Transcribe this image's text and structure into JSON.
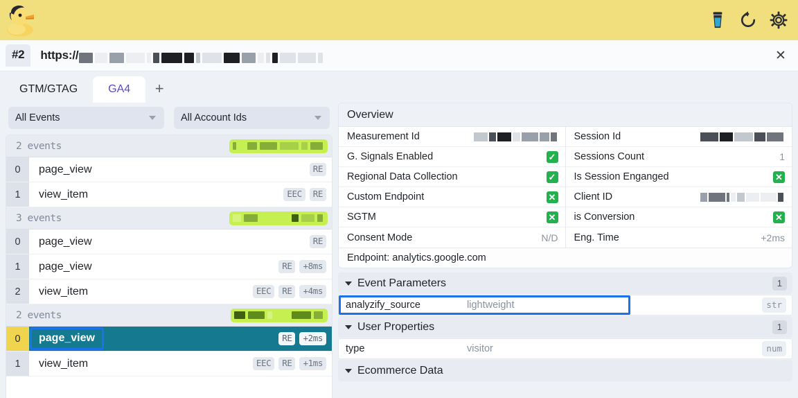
{
  "app": {
    "logo_icon": "duck-logo",
    "toolbar_icons": [
      "coffee-cup-icon",
      "refresh-icon",
      "gear-icon"
    ]
  },
  "urlbar": {
    "index_badge": "#2",
    "url_prefix": "https://",
    "url_redacted": true,
    "close_label": "✕"
  },
  "tabs": {
    "items": [
      {
        "label": "GTM/GTAG",
        "active": false
      },
      {
        "label": "GA4",
        "active": true
      }
    ],
    "add_label": "+"
  },
  "filters": {
    "event_filter": "All Events",
    "account_filter": "All Account Ids"
  },
  "event_groups": [
    {
      "count_label": "2 events",
      "rows": [
        {
          "index": "0",
          "name": "page_view",
          "chips": [
            "RE"
          ]
        },
        {
          "index": "1",
          "name": "view_item",
          "chips": [
            "EEC",
            "RE"
          ]
        }
      ]
    },
    {
      "count_label": "3 events",
      "rows": [
        {
          "index": "0",
          "name": "page_view",
          "chips": [
            "RE"
          ]
        },
        {
          "index": "1",
          "name": "page_view",
          "chips": [
            "RE",
            "+8ms"
          ]
        },
        {
          "index": "2",
          "name": "view_item",
          "chips": [
            "EEC",
            "RE",
            "+4ms"
          ]
        }
      ]
    },
    {
      "count_label": "2 events",
      "rows": [
        {
          "index": "0",
          "name": "page_view",
          "chips": [
            "RE",
            "+2ms"
          ],
          "selected": true
        },
        {
          "index": "1",
          "name": "view_item",
          "chips": [
            "EEC",
            "RE",
            "+1ms"
          ]
        }
      ]
    }
  ],
  "overview": {
    "title": "Overview",
    "left_rows": [
      {
        "key": "Measurement Id",
        "value": "",
        "redacted": true
      },
      {
        "key": "G. Signals Enabled",
        "value": "✓",
        "mark": "check"
      },
      {
        "key": "Regional Data Collection",
        "value": "✓",
        "mark": "check"
      },
      {
        "key": "Custom Endpoint",
        "value": "✕",
        "mark": "cross"
      },
      {
        "key": "SGTM",
        "value": "✕",
        "mark": "cross"
      },
      {
        "key": "Consent Mode",
        "value": "N/D"
      }
    ],
    "right_rows": [
      {
        "key": "Session Id",
        "value": "",
        "redacted": true
      },
      {
        "key": "Sessions Count",
        "value": "1"
      },
      {
        "key": "Is Session Enganged",
        "value": "✕",
        "mark": "cross"
      },
      {
        "key": "Client ID",
        "value": "",
        "redacted": true
      },
      {
        "key": "is Conversion",
        "value": "✕",
        "mark": "cross"
      },
      {
        "key": "Eng. Time",
        "value": "+2ms"
      }
    ],
    "endpoint": "Endpoint: analytics.google.com"
  },
  "sections": [
    {
      "title": "Event Parameters",
      "count": "1",
      "rows": [
        {
          "key": "analyzify_source",
          "value": "lightweight",
          "type": "str",
          "highlighted": true
        }
      ]
    },
    {
      "title": "User Properties",
      "count": "1",
      "rows": [
        {
          "key": "type",
          "value": "visitor",
          "type": "num"
        }
      ]
    },
    {
      "title": "Ecommerce Data",
      "count": "",
      "rows": []
    }
  ],
  "colors": {
    "topbar": "#f0df7c",
    "accent_purple": "#5c49c4",
    "selected_row": "#15798f",
    "focus_outline": "#1a73e8",
    "green_chip": "#c6ef52",
    "status_green": "#22b14c",
    "index_selected": "#f0d44e"
  }
}
